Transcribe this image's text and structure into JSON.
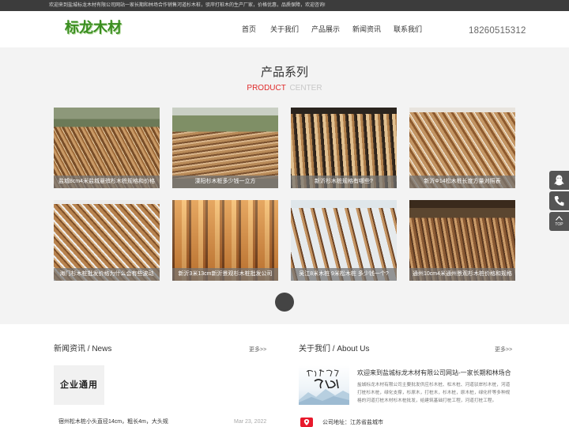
{
  "topbar": {
    "text": "欢迎来到盐城标龙木材有限公司网站一家长期和林场合作销售河道杉木桩，驳岸打桩木的生产厂家，价格优惠，品质保障，欢迎咨询!"
  },
  "header": {
    "logo": "标龙木材",
    "nav": [
      "首页",
      "关于我们",
      "产品展示",
      "新闻资讯",
      "联系我们"
    ],
    "phone": "18260515312"
  },
  "products": {
    "title": "产品系列",
    "subtitle_highlight": "PRODUCT",
    "subtitle_rest": "CENTER",
    "items": [
      {
        "caption": "盐城8cm4米盐城悬殡杉木桩规格和价格"
      },
      {
        "caption": "溧阳杉木桩多少钱一立方"
      },
      {
        "caption": "新沂杉木桩规格有哪些?"
      },
      {
        "caption": "新沂Φ14松木桩长度方量对照表"
      },
      {
        "caption": "海门杉木桩批发价格为什么会有些波动"
      },
      {
        "caption": "新沂3米13cm新沂景观杉木桩批发公司"
      },
      {
        "caption": "吴江8米木桩 9米松木桩 多少钱一个?"
      },
      {
        "caption": "通州10cm4米通州景观杉木桩价格和规格（"
      }
    ]
  },
  "news": {
    "title": "新闻资讯 / News",
    "more": "更多>>",
    "banner_text": "企业通用",
    "items": [
      {
        "title": "宿州松木桩小头直径14cm，粗长4m，大头规",
        "date": "Mar 23, 2022"
      }
    ]
  },
  "about": {
    "title": "关于我们 / About Us",
    "more": "更多>>",
    "headline": "欢迎来到盐城标龙木材有限公司网站-一家长期和林场合",
    "description": "盐城标龙木材有限公司主要批发供应杉木桩、松木桩、河道驳岸杉木桩，河道打桩杉木桩，绿化支撑，杉原木，打桩木，杉木桩，原木桩，绿化杆等多种规格的河道打桩木材杉木桩批发，给建筑基础打桩工程，河道打桩工程。",
    "address": "公司地址：江苏省盐城市"
  },
  "float": {
    "top_label": "TOP"
  },
  "icons": {
    "qq": "qq-icon",
    "phone": "phone-icon",
    "top": "arrow-up-icon",
    "address": "location-icon"
  },
  "theme": {
    "brand_green": "#3a8e20",
    "accent_red": "#e02b2b",
    "topbar_bg": "#3c3c3c",
    "section_bg": "#f3f3f3"
  }
}
